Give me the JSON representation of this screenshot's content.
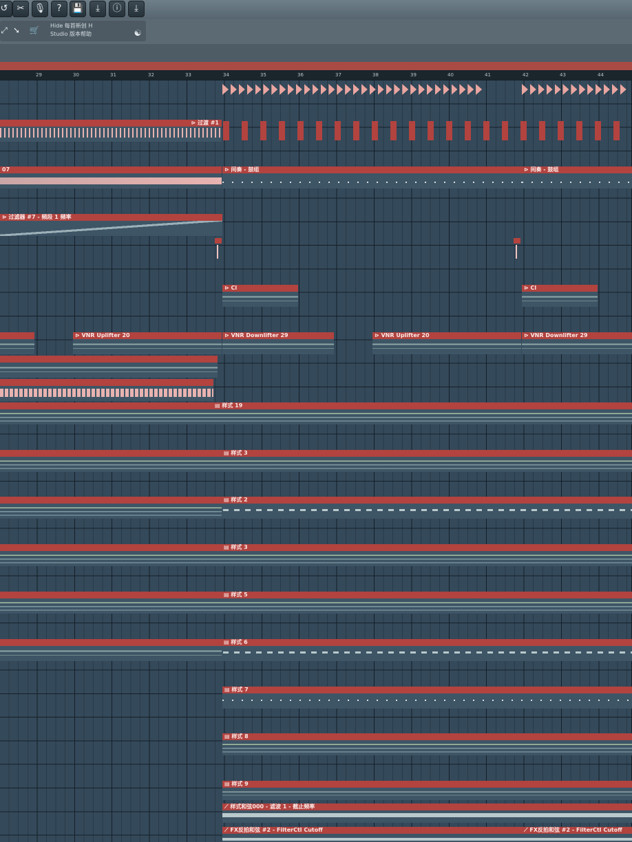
{
  "toolbar": {
    "buttons": [
      {
        "name": "undo-button",
        "glyph": "↺"
      },
      {
        "name": "cut-button",
        "glyph": "✂"
      },
      {
        "name": "record-button",
        "glyph": "🎙"
      },
      {
        "name": "help-button",
        "glyph": "?"
      },
      {
        "name": "save-button",
        "glyph": "💾"
      },
      {
        "name": "export-button",
        "glyph": "⤓"
      },
      {
        "name": "info-button",
        "glyph": "ⓘ"
      },
      {
        "name": "download-button",
        "glyph": "⤓"
      }
    ]
  },
  "hint_bar": {
    "line1": "Hide 每首新创 H",
    "line2": "Studio 版本帮助"
  },
  "ruler": {
    "bars": [
      "",
      "29",
      "30",
      "31",
      "32",
      "33",
      "34",
      "35",
      "36",
      "37",
      "38",
      "39",
      "40",
      "41",
      "42",
      "43",
      "44"
    ]
  },
  "clips": [
    {
      "label": "⊳ 过渡 #1"
    },
    {
      "label": "07"
    },
    {
      "label": "⊳ 间奏 - 鼓组"
    },
    {
      "label": "⊳ 间奏 - 鼓组"
    },
    {
      "label": "⊳ 过滤器 #7 - 频段 1 频率"
    },
    {
      "label": "⊳ Cl"
    },
    {
      "label": "⊳ Cl"
    },
    {
      "label": "⊳ VNR Uplifter 20"
    },
    {
      "label": "⊳ VNR Downlifter 29"
    },
    {
      "label": "⊳ VNR Uplifter 20"
    },
    {
      "label": "⊳ VNR Downlifter 29"
    },
    {
      "label": "▤ 样式 19"
    },
    {
      "label": "▤ 样式 3"
    },
    {
      "label": "▤ 样式 2"
    },
    {
      "label": "▤ 样式 3"
    },
    {
      "label": "▤ 样式 5"
    },
    {
      "label": "▤ 样式 6"
    },
    {
      "label": "▤ 样式 7"
    },
    {
      "label": "▤ 样式 8"
    },
    {
      "label": "▤ 样式 9"
    },
    {
      "label": "⟋ 样式和弦000 - 滤波 1 - 截止频率"
    },
    {
      "label": "⟋ FX反拍和弦 #2 - FilterCtl Cutoff"
    },
    {
      "label": "⟋ FX反拍和弦 #2 - FilterCtl Cutoff"
    }
  ],
  "colors": {
    "clip_header": "#b2433f",
    "grid_bg": "#34495a",
    "toolbar": "#5c6a74"
  }
}
